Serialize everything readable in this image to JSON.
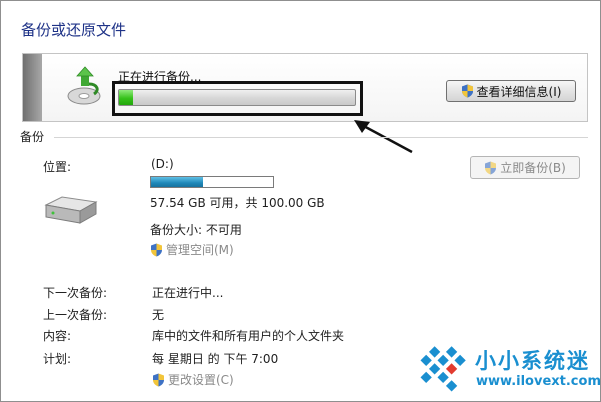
{
  "page_title": "备份或还原文件",
  "status": {
    "text": "正在进行备份...",
    "progress_fraction": 0.06,
    "details_button_label": "查看详细信息(I)"
  },
  "section": {
    "label": "备份"
  },
  "location": {
    "label": "位置:",
    "drive": "(D:)",
    "used_fraction": 0.43,
    "space_text": "57.54 GB 可用，共 100.00 GB",
    "backup_size_text": "备份大小: 不可用",
    "manage_space_link": "管理空间(M)",
    "backup_now_button": "立即备份(B)"
  },
  "info": {
    "next_backup_label": "下一次备份:",
    "next_backup_value": "正在进行中...",
    "last_backup_label": "上一次备份:",
    "last_backup_value": "无",
    "contents_label": "内容:",
    "contents_value": "库中的文件和所有用户的个人文件夹",
    "schedule_label": "计划:",
    "schedule_value": "每 星期日 的 下午 7:00",
    "change_settings_link": "更改设置(C)"
  },
  "watermark": {
    "title": "小小系统迷",
    "url": "www.ilovext.com"
  },
  "colors": {
    "title_blue": "#1e3287",
    "progress_green": "#36c21a",
    "disk_blue": "#1f88b8",
    "watermark_blue": "#1a8fd0"
  }
}
